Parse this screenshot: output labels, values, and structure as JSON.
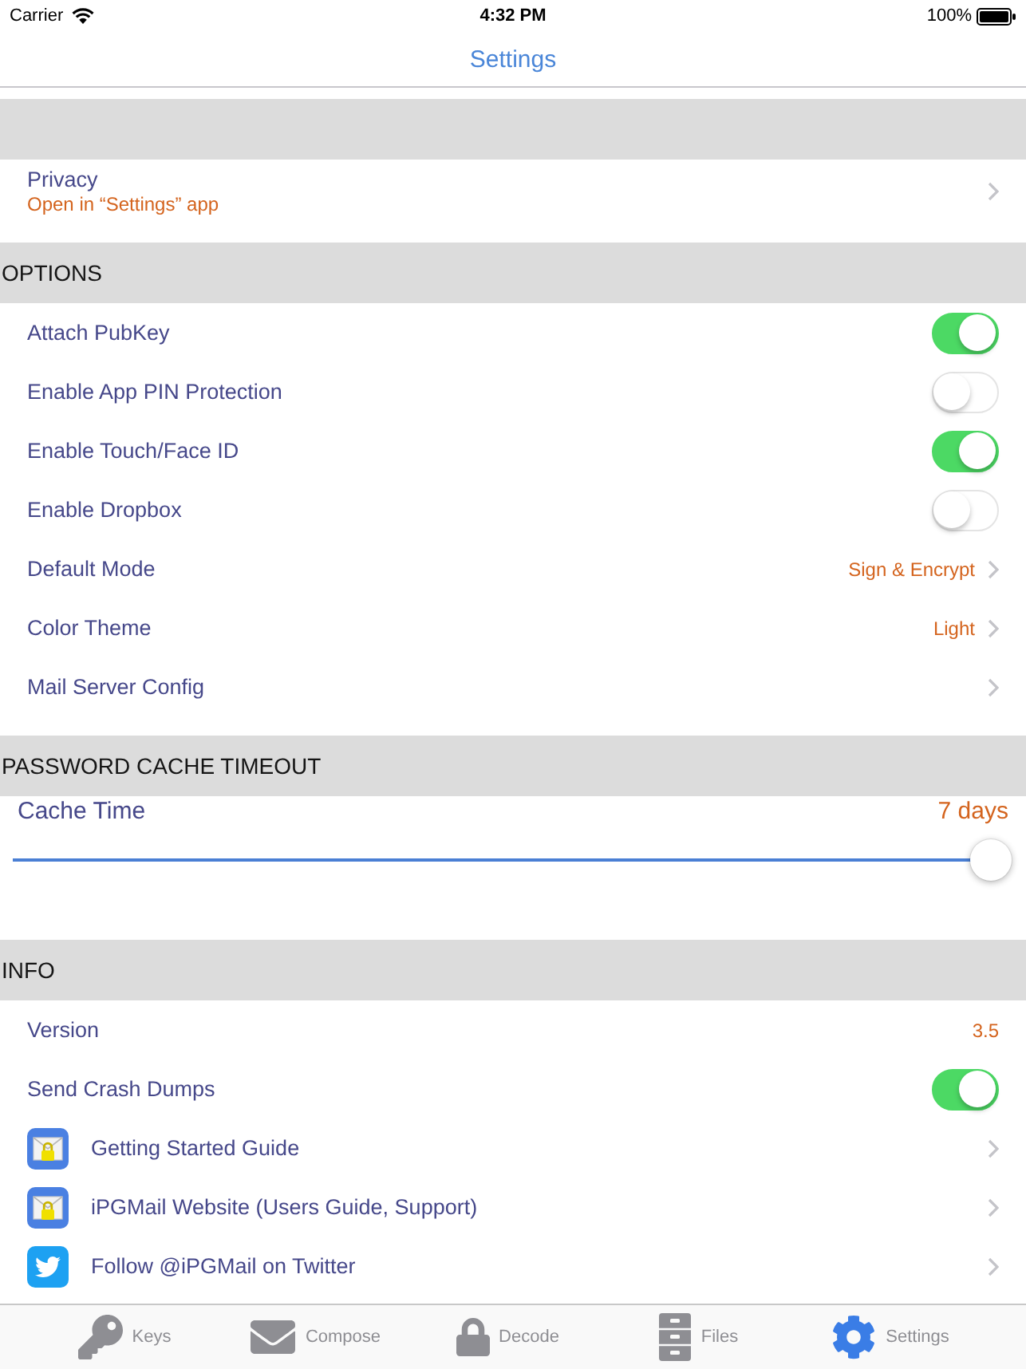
{
  "status_bar": {
    "carrier": "Carrier",
    "time": "4:32 PM",
    "battery": "100%"
  },
  "nav_bar": {
    "title": "Settings"
  },
  "sections": [
    {
      "rows": [
        {
          "kind": "disclosure",
          "label": "Privacy",
          "subtitle": "Open in “Settings” app"
        }
      ]
    },
    {
      "header": "OPTIONS",
      "rows": [
        {
          "kind": "toggle",
          "label": "Attach PubKey",
          "on": true
        },
        {
          "kind": "toggle",
          "label": "Enable App PIN Protection",
          "on": false
        },
        {
          "kind": "toggle",
          "label": "Enable Touch/Face ID",
          "on": true
        },
        {
          "kind": "toggle",
          "label": "Enable Dropbox",
          "on": false
        },
        {
          "kind": "disclosure",
          "label": "Default Mode",
          "value": "Sign & Encrypt"
        },
        {
          "kind": "disclosure",
          "label": "Color Theme",
          "value": "Light"
        },
        {
          "kind": "disclosure",
          "label": "Mail Server Config"
        }
      ]
    },
    {
      "header": "PASSWORD CACHE TIMEOUT",
      "rows": [
        {
          "kind": "slider",
          "label": "Cache Time",
          "reading": "7 days",
          "level": 1
        }
      ]
    },
    {
      "header": "INFO",
      "rows": [
        {
          "kind": "value",
          "label": "Version",
          "value": "3.5"
        },
        {
          "kind": "toggle",
          "label": "Send Crash Dumps",
          "on": true
        },
        {
          "kind": "app_link",
          "label": "Getting Started Guide"
        },
        {
          "kind": "app_link",
          "label": "iPGMail Website (Users Guide, Support)"
        },
        {
          "kind": "social_link",
          "label": "Follow @iPGMail on Twitter"
        }
      ]
    }
  ],
  "tab_bar": {
    "tabs": [
      {
        "label": "Keys",
        "selected": false
      },
      {
        "label": "Compose",
        "selected": false
      },
      {
        "label": "Decode",
        "selected": false
      },
      {
        "label": "Files",
        "selected": false
      },
      {
        "label": "Settings",
        "selected": true
      }
    ]
  }
}
